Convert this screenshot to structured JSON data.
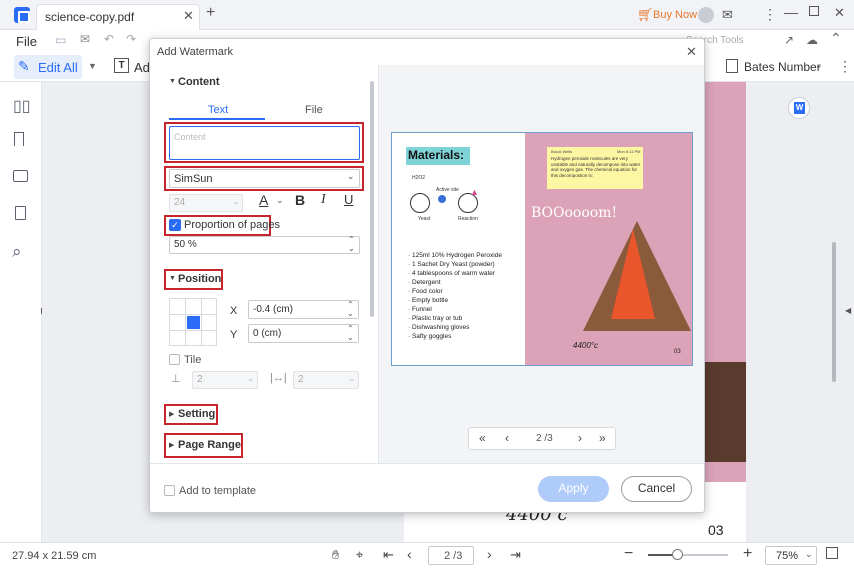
{
  "app": {
    "tab_title": "science-copy.pdf",
    "buy_now": "Buy Now"
  },
  "menu": {
    "file": "File",
    "search_tools": "Search Tools"
  },
  "toolbar": {
    "edit_all": "Edit All",
    "add_text": "Ad",
    "bates": "Bates Number"
  },
  "dialog": {
    "title": "Add Watermark",
    "section_content": "Content",
    "tab_text": "Text",
    "tab_file": "File",
    "content_placeholder": "Content",
    "font": "SimSun",
    "font_size": "24",
    "proportion_label": "Proportion of pages",
    "proportion_value": "50 %",
    "section_position": "Position",
    "x_label": "X",
    "x_value": "-0.4 (cm)",
    "y_label": "Y",
    "y_value": "0 (cm)",
    "tile_label": "Tile",
    "tile_h": "2",
    "tile_v": "2",
    "section_setting": "Setting",
    "section_page_range": "Page Range",
    "add_to_template": "Add to template",
    "apply": "Apply",
    "cancel": "Cancel",
    "page_indicator": "2 /3"
  },
  "preview": {
    "materials_title": "Materials:",
    "materials_list": [
      "125ml 10% Hydrogen Peroxide",
      "1 Sachet Dry Yeast (powder)",
      "4 tablespoons of warm water",
      "Detergent",
      "Food color",
      "Empty bottle",
      "Funnel",
      "Plastic tray or tub",
      "Dishwashing gloves",
      "Safty goggles"
    ],
    "note_author": "Brook Wells",
    "note_time": "Mon 6:11 PM",
    "note_text": "Hydrogen peroxide molecules are very unstable and naturally decompose into water and oxygen gas. The chemical equation for this decompostion is:",
    "boom": "BOOoooom!",
    "temp": "4400°c",
    "page_no": "03",
    "diagram_h2o2": "H2O2",
    "diagram_active": "Active site",
    "diagram_yeast": "Yeast",
    "diagram_reaction": "Reaction"
  },
  "background_page": {
    "temp": "4400 c",
    "page_no": "03"
  },
  "status": {
    "dims": "27.94 x 21.59 cm",
    "page": "2 /3",
    "zoom": "75%"
  },
  "colors": {
    "accent": "#2a6cf6",
    "red_highlight": "#c6252c",
    "apply_bg": "#aecbfa",
    "preview_pink": "#dca3b8",
    "materials_teal": "#7fd4d8",
    "note_yellow": "#fdf6a3",
    "lava": "#e9562b"
  }
}
